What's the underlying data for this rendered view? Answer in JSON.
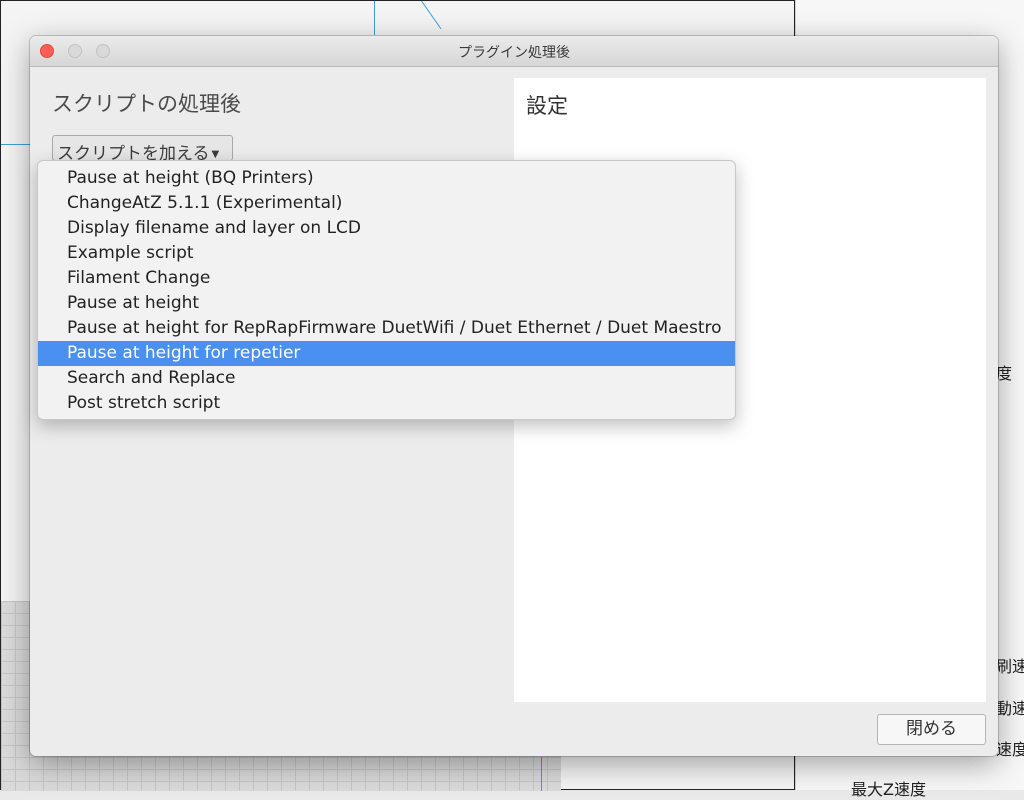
{
  "dialog": {
    "title": "プラグイン処理後",
    "left_heading": "スクリプトの処理後",
    "add_script_label": "スクリプトを加える",
    "settings_heading": "設定",
    "close_label": "閉める"
  },
  "dropdown": {
    "selected_index": 7,
    "items": [
      "Pause at height (BQ Printers)",
      "ChangeAtZ 5.1.1 (Experimental)",
      "Display filename and layer on LCD",
      "Example script",
      "Filament Change",
      "Pause at height",
      "Pause at height for RepRapFirmware DuetWifi / Duet Ethernet / Duet Maestro",
      "Pause at height for repetier",
      "Search and Replace",
      "Post stretch script"
    ]
  },
  "background": {
    "right_panel_fragments": [
      "度",
      "刷速",
      "動速",
      "速度",
      "最大Z速度"
    ]
  },
  "colors": {
    "selection": "#4a90f0",
    "close_traffic_light": "#fc5f57"
  }
}
